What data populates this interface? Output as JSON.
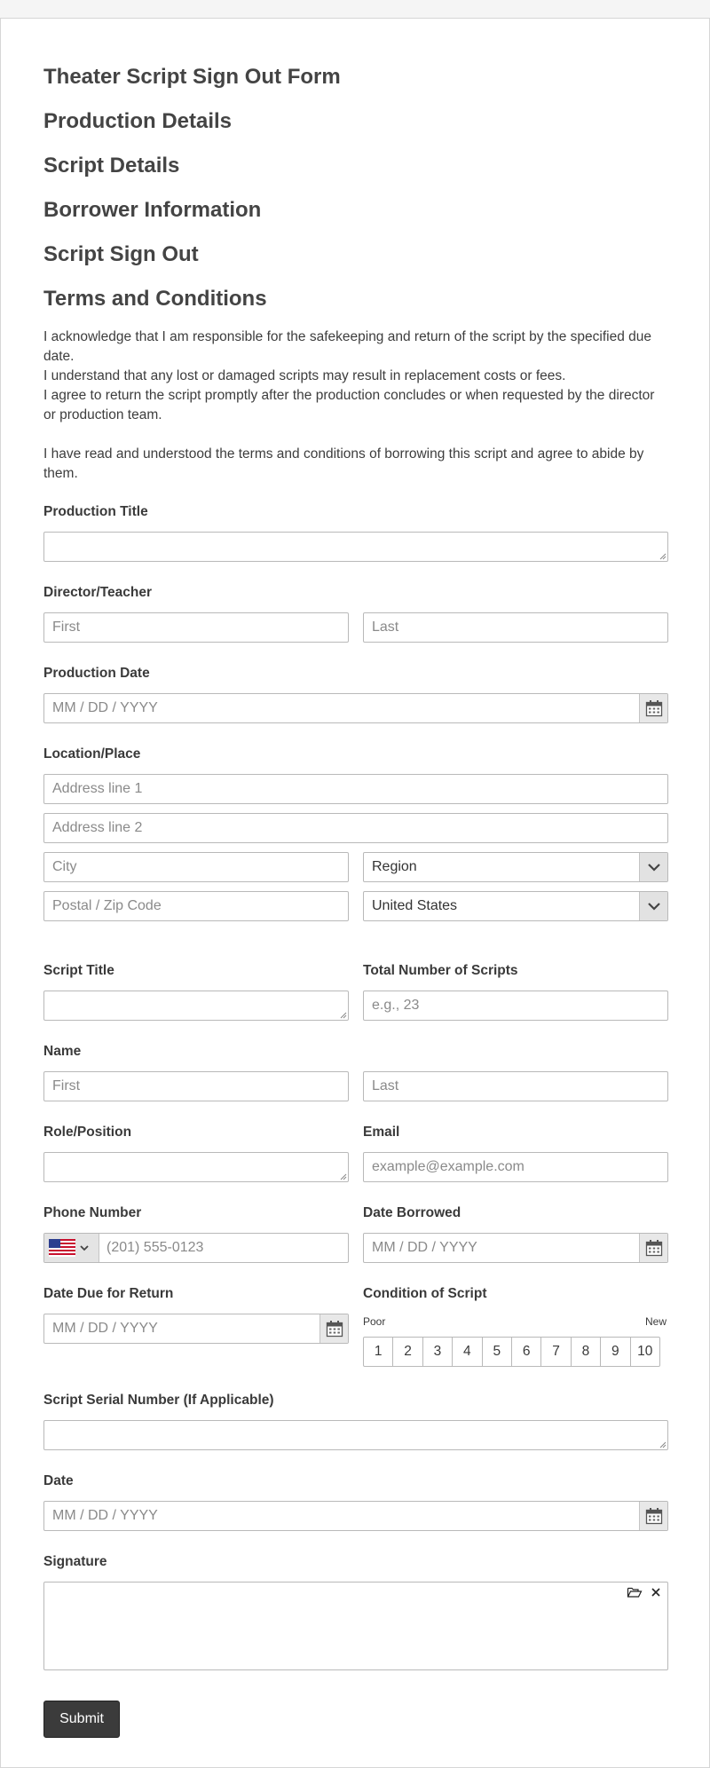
{
  "headings": {
    "form_title": "Theater Script Sign Out Form",
    "production_details": "Production Details",
    "script_details": "Script Details",
    "borrower_information": "Borrower Information",
    "script_sign_out": "Script Sign Out",
    "terms_and_conditions": "Terms and Conditions"
  },
  "terms": {
    "line1": "I acknowledge that I am responsible for the safekeeping and return of the script by the specified due date.",
    "line2": "I understand that any lost or damaged scripts may result in replacement costs or fees.",
    "line3": "I agree to return the script promptly after the production concludes or when requested by the director or production team.",
    "line4": "I have read and understood the terms and conditions of borrowing this script and agree to abide by them."
  },
  "fields": {
    "production_title": {
      "label": "Production Title"
    },
    "director": {
      "label": "Director/Teacher",
      "first_placeholder": "First",
      "last_placeholder": "Last"
    },
    "production_date": {
      "label": "Production Date",
      "placeholder": "MM / DD / YYYY"
    },
    "location": {
      "label": "Location/Place",
      "address1_placeholder": "Address line 1",
      "address2_placeholder": "Address line 2",
      "city_placeholder": "City",
      "region_value": "Region",
      "postal_placeholder": "Postal / Zip Code",
      "country_value": "United States"
    },
    "script_title": {
      "label": "Script Title"
    },
    "total_scripts": {
      "label": "Total Number of Scripts",
      "placeholder": "e.g., 23"
    },
    "name": {
      "label": "Name",
      "first_placeholder": "First",
      "last_placeholder": "Last"
    },
    "role": {
      "label": "Role/Position"
    },
    "email": {
      "label": "Email",
      "placeholder": "example@example.com"
    },
    "phone": {
      "label": "Phone Number",
      "placeholder": "(201) 555-0123"
    },
    "date_borrowed": {
      "label": "Date Borrowed",
      "placeholder": "MM / DD / YYYY"
    },
    "date_due": {
      "label": "Date Due for Return",
      "placeholder": "MM / DD / YYYY"
    },
    "condition": {
      "label": "Condition of Script",
      "low_label": "Poor",
      "high_label": "New",
      "options": [
        "1",
        "2",
        "3",
        "4",
        "5",
        "6",
        "7",
        "8",
        "9",
        "10"
      ]
    },
    "serial": {
      "label": "Script Serial Number (If Applicable)"
    },
    "date": {
      "label": "Date",
      "placeholder": "MM / DD / YYYY"
    },
    "signature": {
      "label": "Signature"
    }
  },
  "submit_label": "Submit",
  "colors": {
    "button_bg": "#3b3b3b",
    "border": "#b9b9b9",
    "accent_gray": "#e2e2e2"
  }
}
